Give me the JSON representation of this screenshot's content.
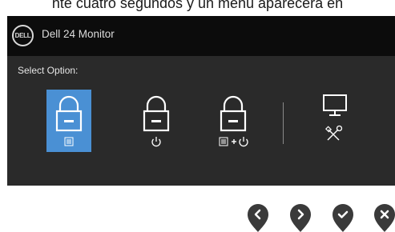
{
  "caption": "nte cuatro segundos y un menú aparecerá en",
  "osd": {
    "logo_text": "DELL",
    "model": "Dell 24 Monitor",
    "select_label": "Select Option:",
    "options": [
      {
        "name": "menu-lock",
        "sub_icons": [
          "menu-icon"
        ],
        "selected": true
      },
      {
        "name": "power-lock",
        "sub_icons": [
          "power-icon"
        ],
        "selected": false
      },
      {
        "name": "menu-power-lock",
        "sub_icons": [
          "menu-icon",
          "plus",
          "power-icon"
        ],
        "selected": false
      },
      {
        "name": "built-in-diagnostics",
        "sub_icons": [
          "monitor-icon",
          "tools-icon"
        ],
        "selected": false
      }
    ]
  },
  "nav_buttons": [
    "left-chevron-icon",
    "right-chevron-icon",
    "check-icon",
    "close-icon"
  ],
  "colors": {
    "osd_bg": "#2a2a2a",
    "header_bg": "#0c0c0c",
    "selected_bg": "#4a90d4",
    "button_fill": "#3a3a3a"
  }
}
